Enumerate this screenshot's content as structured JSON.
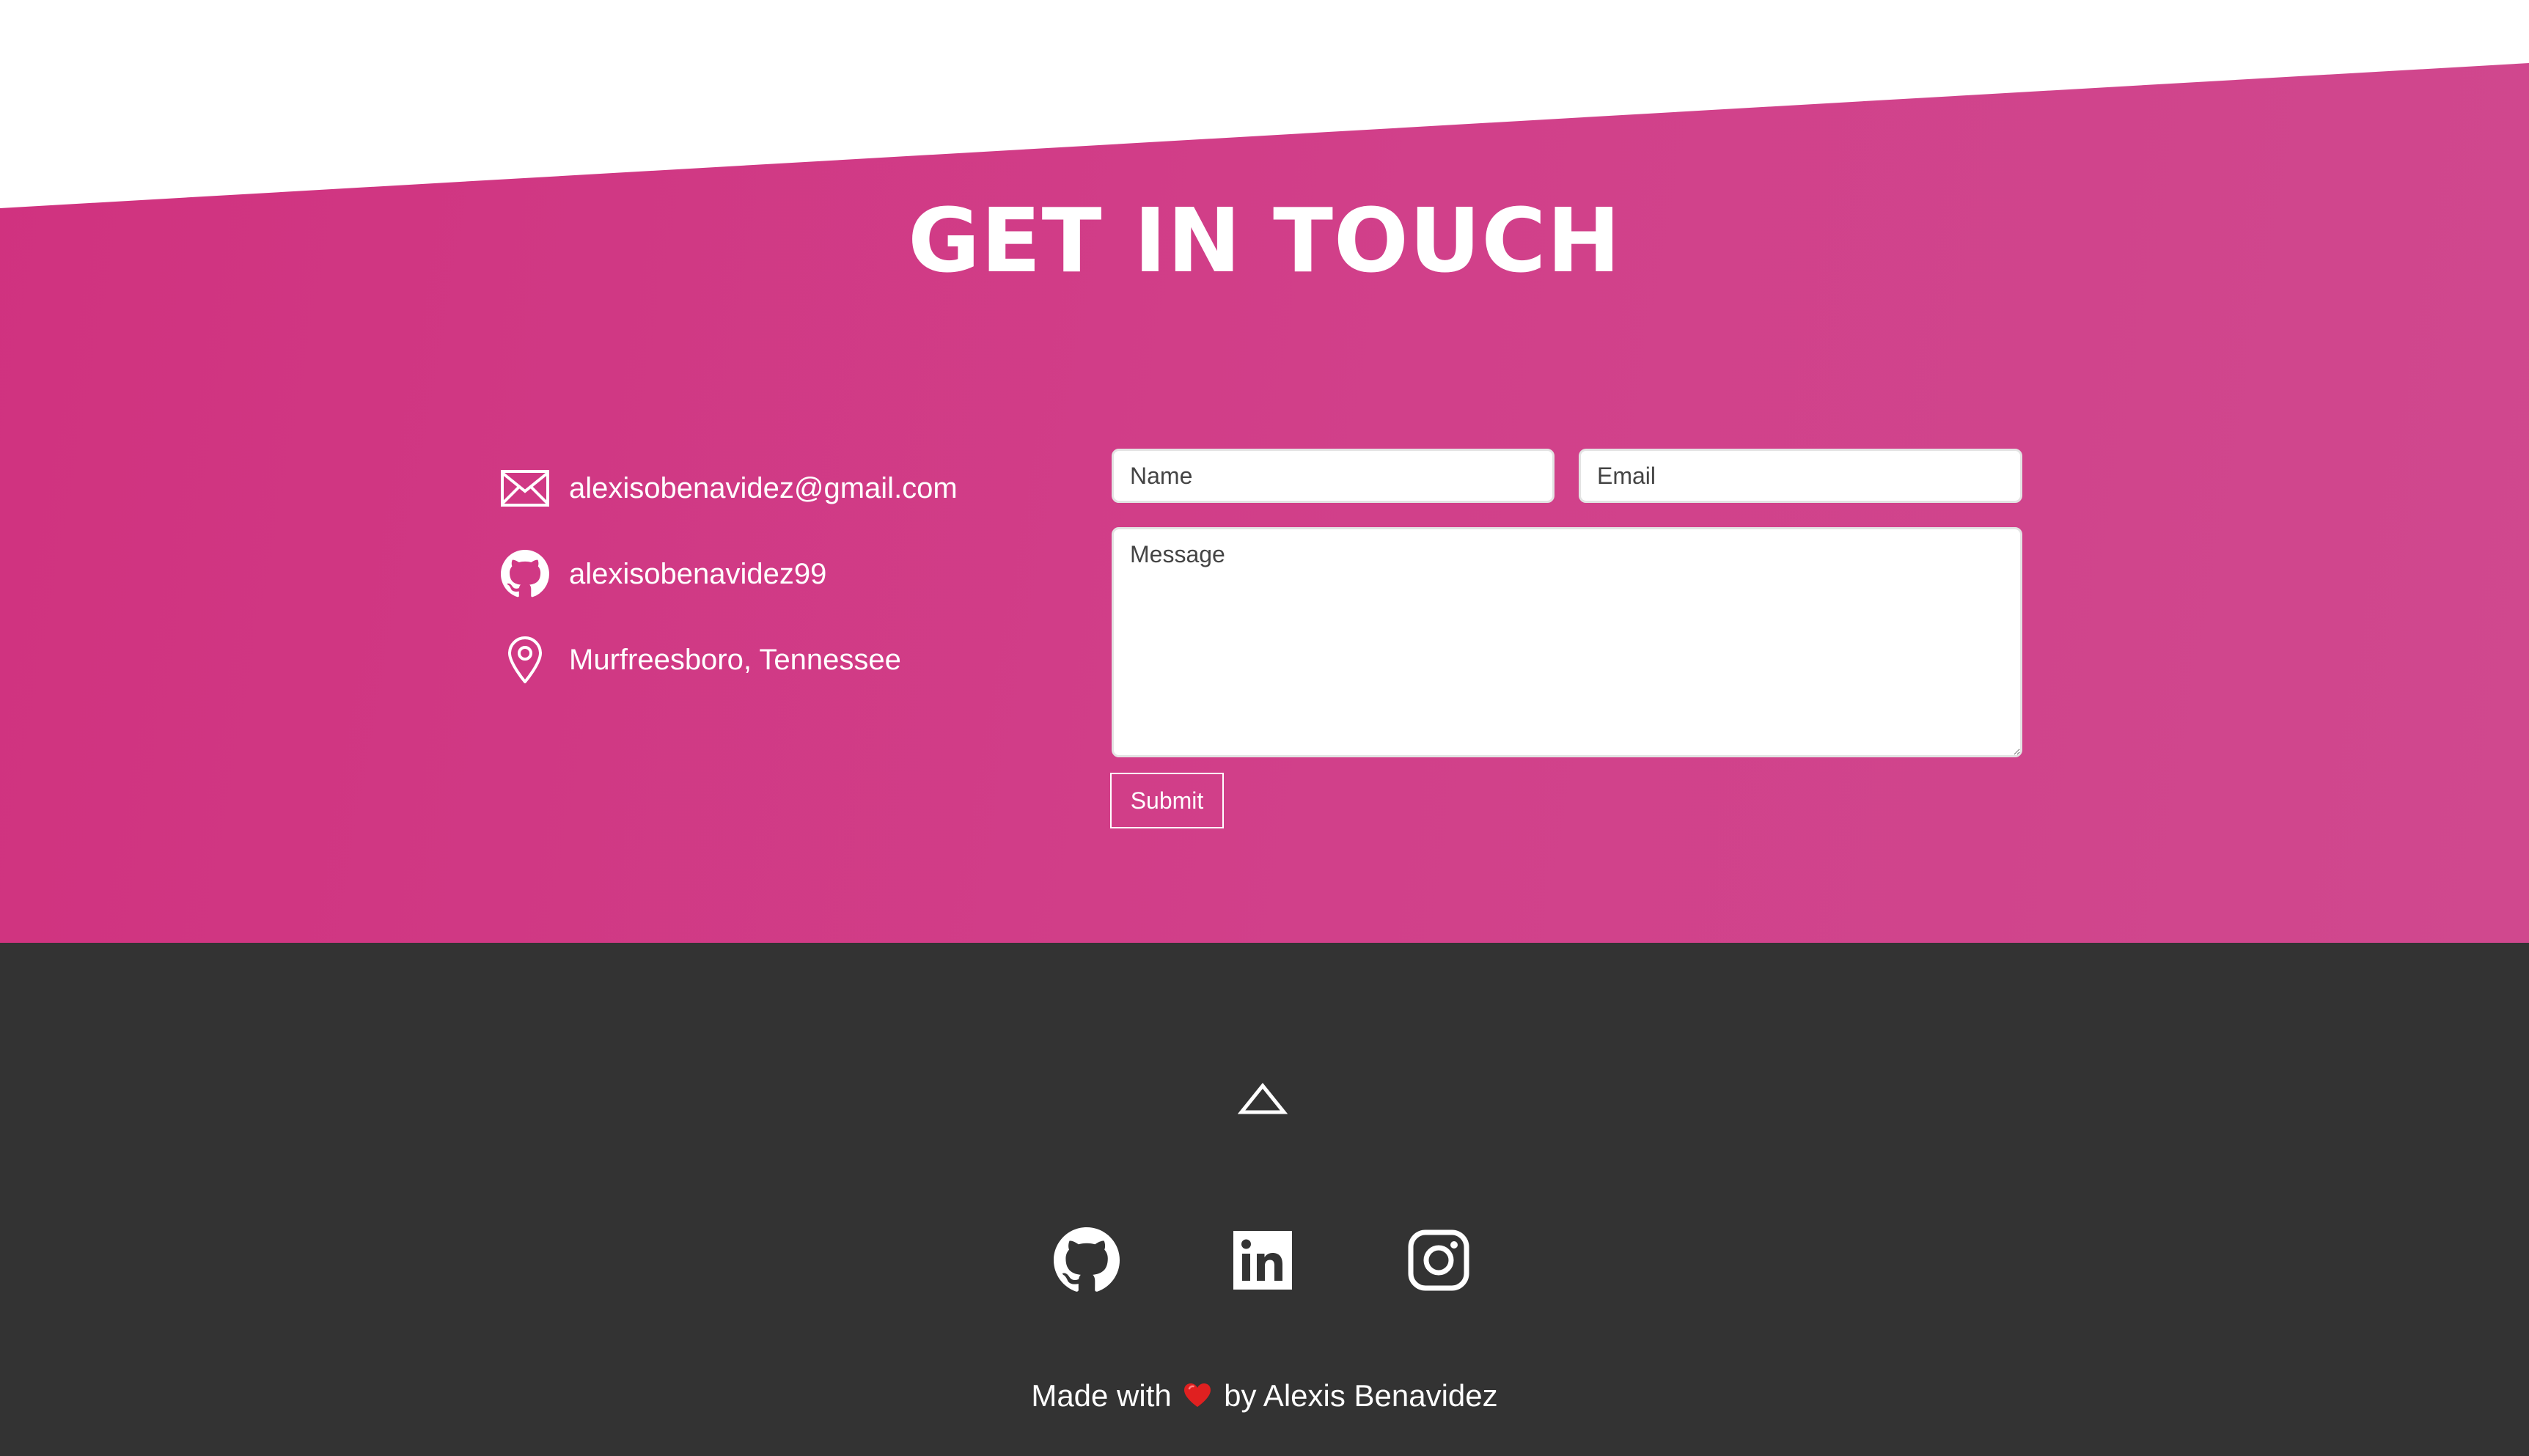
{
  "contact": {
    "title": "GET IN TOUCH",
    "info": [
      {
        "icon": "envelope-icon",
        "text": "alexisobenavidez@gmail.com"
      },
      {
        "icon": "github-icon",
        "text": "alexisobenavidez99"
      },
      {
        "icon": "location-pin-icon",
        "text": "Murfreesboro, Tennessee"
      }
    ],
    "form": {
      "name_placeholder": "Name",
      "email_placeholder": "Email",
      "message_placeholder": "Message",
      "submit_label": "Submit"
    }
  },
  "footer": {
    "scroll_top_icon": "chevron-up-icon",
    "social": [
      {
        "icon": "github-icon",
        "label": "GitHub"
      },
      {
        "icon": "linkedin-icon",
        "label": "LinkedIn"
      },
      {
        "icon": "instagram-icon",
        "label": "Instagram"
      }
    ],
    "credit_prefix": "Made with",
    "credit_icon": "heart-icon",
    "credit_suffix": "by Alexis Benavidez"
  },
  "colors": {
    "contact_background": "#d0327f",
    "contact_background_end": "#d0488e",
    "footer_background": "#333333",
    "text": "#ffffff",
    "heart": "#e02020"
  }
}
